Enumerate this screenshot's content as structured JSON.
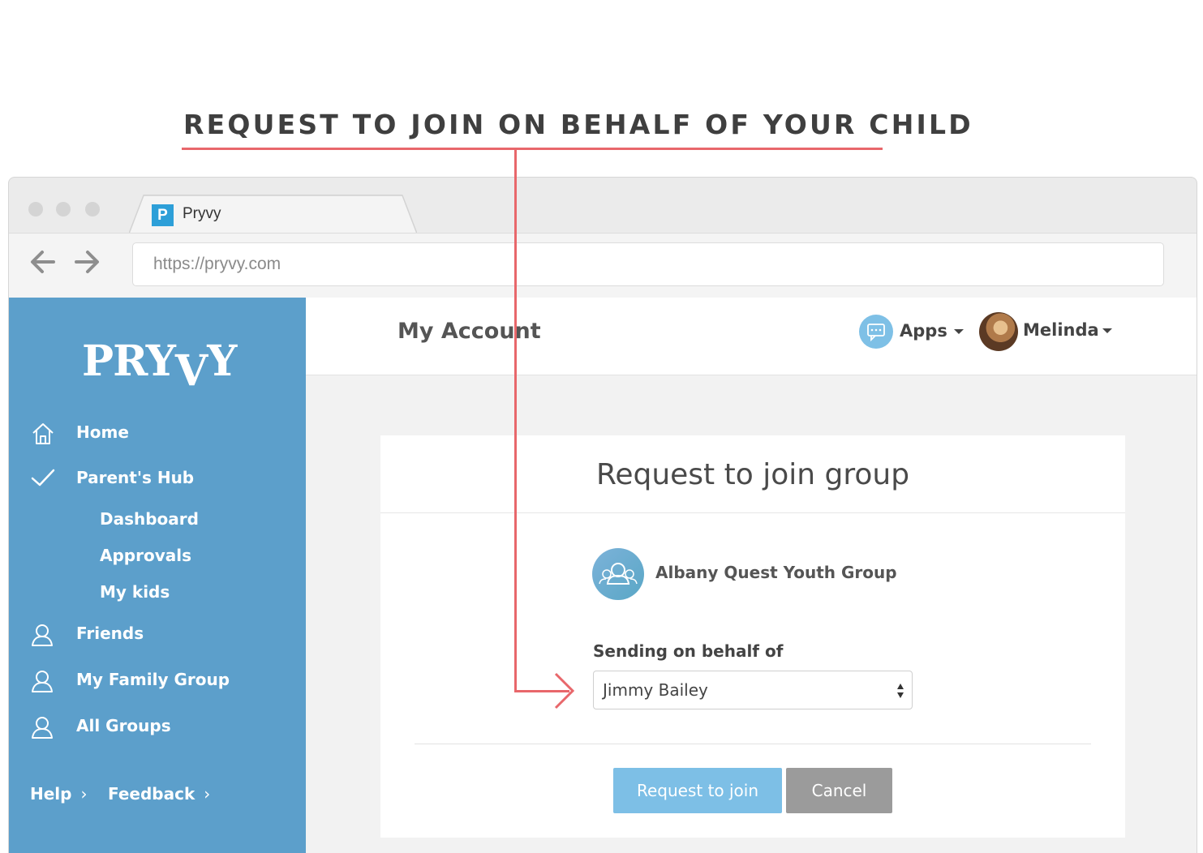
{
  "callout": {
    "title": "REQUEST TO JOIN ON BEHALF OF YOUR CHILD",
    "accent_color": "#e8676b"
  },
  "browser": {
    "tab_favicon": "P",
    "tab_title": "Pryvy",
    "url": "https://pryvy.com"
  },
  "sidebar": {
    "logo": "PRYVY",
    "items": [
      {
        "label": "Home",
        "icon": "house-icon"
      },
      {
        "label": "Parent's Hub",
        "icon": "checkmark-icon"
      },
      {
        "label": "Friends",
        "icon": "person-icon"
      },
      {
        "label": "My Family Group",
        "icon": "person-icon"
      },
      {
        "label": "All Groups",
        "icon": "person-icon"
      }
    ],
    "sub_items": [
      "Dashboard",
      "Approvals",
      "My kids"
    ],
    "footer": {
      "help": "Help",
      "feedback": "Feedback"
    },
    "background": "#5c9fcb"
  },
  "header": {
    "title": "My Account",
    "apps_label": "Apps",
    "user_name": "Melinda"
  },
  "dialog": {
    "title": "Request to join group",
    "group_name": "Albany Quest Youth Group",
    "field_label": "Sending on behalf of",
    "selected_child": "Jimmy Bailey",
    "request_button": "Request to join",
    "cancel_button": "Cancel",
    "request_color": "#7dbfe6",
    "cancel_color": "#9b9b9b"
  }
}
